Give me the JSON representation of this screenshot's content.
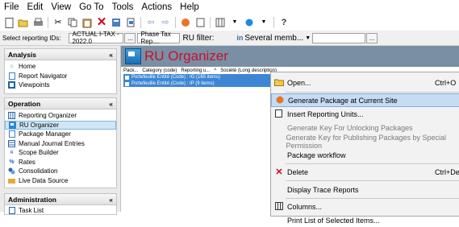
{
  "menubar": [
    "File",
    "Edit",
    "View",
    "Go To",
    "Tools",
    "Actions",
    "Help"
  ],
  "toolbar": {
    "icons": [
      "new-icon",
      "open-icon",
      "print-icon",
      "cut-icon",
      "copy-icon",
      "paste-icon",
      "delete-icon",
      "properties-icon",
      "back-icon",
      "forward-icon",
      "package-icon",
      "page-icon",
      "grid-icon",
      "status-icon",
      "help-icon"
    ]
  },
  "filter": {
    "reporting_ids_label": "Select reporting IDs:",
    "reporting_ids_value": "ACTUAL I-TAX - 2022.0",
    "ellipsis": "...",
    "phase_value": "Phase Tax Rep....",
    "ru_filter_label": "RU filter:",
    "in_label": "in",
    "several_label": "Several memb...",
    "ellipsis2": "..."
  },
  "nav": {
    "analysis": {
      "title": "Analysis",
      "items": [
        "Home",
        "Report Navigator",
        "Viewpoints"
      ]
    },
    "operation": {
      "title": "Operation",
      "items": [
        "Reporting Organizer",
        "RU Organizer",
        "Package Manager",
        "Manual Journal Entries",
        "Scope Builder",
        "Rates",
        "Consolidation",
        "Live Data Source"
      ],
      "selected": "RU Organizer"
    },
    "administration": {
      "title": "Administration",
      "items": [
        "Task List"
      ]
    }
  },
  "main": {
    "title": "RU Organizer",
    "columns": [
      "Pack...",
      "Category (code)",
      "Reporting u...",
      "^",
      "Société (Long description)"
    ],
    "rows": [
      "Portefeuille Entité (Code) : IG (165 items)",
      "Portefeuille Entité (Code) : IP (9 items)"
    ]
  },
  "context_menu": {
    "items": [
      {
        "label": "Open...",
        "shortcut": "Ctrl+O",
        "icon": "open-icon",
        "state": "normal"
      },
      {
        "label": "Generate Package at Current Site",
        "shortcut": "",
        "icon": "package-icon",
        "state": "highlighted"
      },
      {
        "label": "Insert Reporting Units...",
        "shortcut": "",
        "icon": "insert-icon",
        "state": "normal"
      },
      {
        "label": "Generate Key For Unlocking Packages",
        "shortcut": "",
        "icon": "",
        "state": "disabled"
      },
      {
        "label": "Generate Key for Publishing Packages by Special Permission",
        "shortcut": "",
        "icon": "",
        "state": "disabled"
      },
      {
        "label": "Package workflow",
        "shortcut": "",
        "icon": "",
        "state": "normal"
      },
      {
        "label": "Delete",
        "shortcut": "Ctrl+Del",
        "icon": "delete-icon",
        "state": "normal"
      },
      {
        "label": "Display Trace Reports",
        "shortcut": "",
        "icon": "",
        "state": "normal"
      },
      {
        "label": "Columns...",
        "shortcut": "",
        "icon": "columns-icon",
        "state": "normal"
      },
      {
        "label": "Print List of Selected Items...",
        "shortcut": "",
        "icon": "",
        "state": "normal"
      }
    ]
  }
}
